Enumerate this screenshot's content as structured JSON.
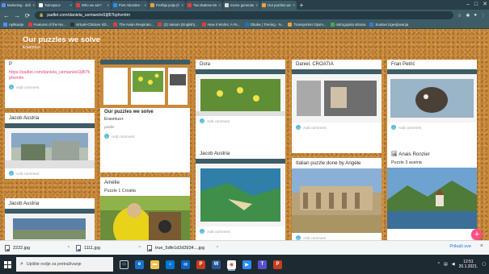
{
  "browser": {
    "tabs": [
      {
        "title": "Marketing - defin",
        "fav": "#5b8def"
      },
      {
        "title": "Twinspace",
        "fav": "#ffffff"
      },
      {
        "title": "Who we are?",
        "fav": "#e43b3b"
      },
      {
        "title": "Post Attendee - Z",
        "fav": "#2d8cff"
      },
      {
        "title": "Proštija polja (C)",
        "fav": "#e8a33b"
      },
      {
        "title": "Two Buttons Me",
        "fav": "#e43b3b"
      },
      {
        "title": "meme generator",
        "fav": "#dddddd"
      },
      {
        "title": "Our puzzles we w",
        "fav": "#f0a03b",
        "active": true
      }
    ],
    "url": "padlet.com/daniela_usmiani/el1lj8l7kphvmlm",
    "bookmarks": [
      {
        "label": "Aplikacije",
        "fav": "#5b8def"
      },
      {
        "label": "Features of the Ne...",
        "fav": "#e43b3b"
      },
      {
        "label": "Virtual+Chicken SD...",
        "fav": "#333333"
      },
      {
        "label": "The Avian Respirato...",
        "fav": "#e43b3b"
      },
      {
        "label": "(2) Varium (English)...",
        "fav": "#e43b3b"
      },
      {
        "label": "How it Works: A Fe...",
        "fav": "#e43b3b"
      },
      {
        "label": "Obuka | Trening - N...",
        "fav": "#2a6db7"
      },
      {
        "label": "Transporteri Opsm...",
        "fav": "#f0a03b"
      },
      {
        "label": "ostrogojska sitrana",
        "fav": "#4aa84a"
      },
      {
        "label": "Sustavi izgevljavanja",
        "fav": "#3a7bd5"
      }
    ]
  },
  "padlet": {
    "title": "Our puzzles we solve",
    "subtitle": "Erasmus+",
    "add_comment": "Add comment",
    "cards": {
      "c1_author": "P",
      "c1_link": "https://padlet.com/daniela_usmiani/el1lj8l7kphvmlm",
      "c1b_author": "Jacob Austria",
      "c1c_author": "Jacob Austria",
      "c2_title": "Our puzzles we solve",
      "c2_sub": "Erasmus+",
      "c2_sub2": "padlet",
      "c2b_author": "Amélie",
      "c2b_body": "Puzzle 1 Croatia",
      "c3_author": "Dora",
      "c3b_author": "Jacob Austria",
      "c4_author": "Daniel, CROATIA",
      "c4b_author": "Italian puzzle done by Angèle",
      "c5_author": "Fran Petrić",
      "c5b_author": "Anais Ronzier",
      "c5b_body": "Puzzle 3 austria"
    }
  },
  "downloads": {
    "items": [
      "2222.jpg",
      "1111.jpg",
      "true_5dfe1d2d3934....jpg"
    ],
    "show_all": "Prikaži sve"
  },
  "taskbar": {
    "search_placeholder": "Upišite ovdje za pretraživanje",
    "time": "12:51",
    "date": "20.1.2021."
  }
}
